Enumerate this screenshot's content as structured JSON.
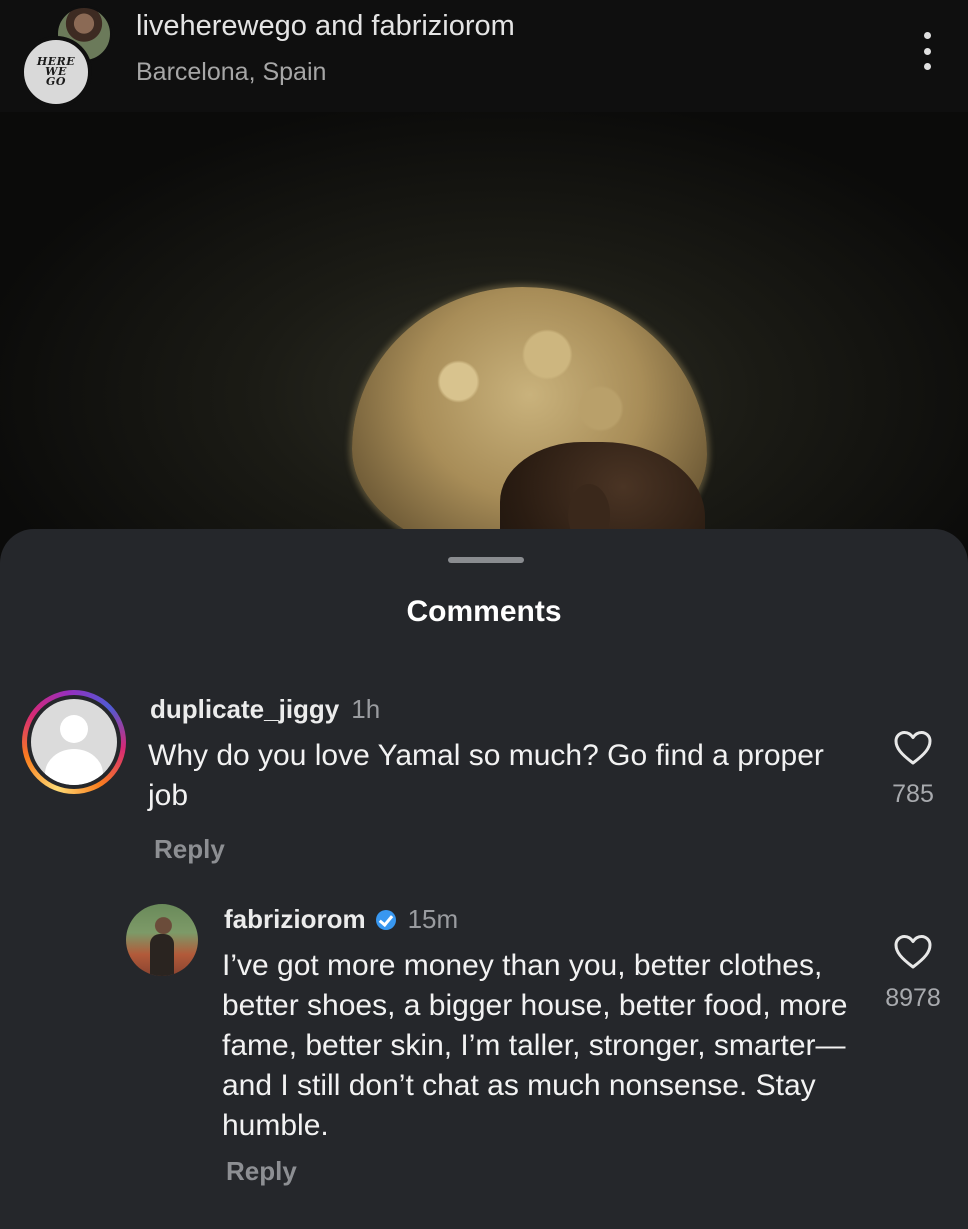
{
  "header": {
    "owner_line": "liveherewego and fabriziorom",
    "location": "Barcelona, Spain",
    "logo_text": [
      "HERE",
      "WE",
      "GO"
    ]
  },
  "sheet": {
    "title": "Comments"
  },
  "comments": [
    {
      "username": "duplicate_jiggy",
      "time": "1h",
      "text": "Why do you love Yamal so much? Go find a proper job",
      "reply_label": "Reply",
      "likes": "785",
      "verified": false
    },
    {
      "username": "fabriziorom",
      "time": "15m",
      "text": "I’ve got more money than you, better clothes, better shoes, a bigger house, better food, more fame, better skin, I’m taller, stronger, smarter—and I still don’t chat as much nonsense. Stay humble.",
      "reply_label": "Reply",
      "likes": "8978",
      "verified": true
    }
  ],
  "icons": {
    "more": "more-vertical-icon",
    "like": "heart-outline-icon",
    "verified": "verified-badge-icon"
  },
  "colors": {
    "sheet_background": "#25272b",
    "verified_blue": "#3897f0",
    "muted_text": "#9a9ca0"
  }
}
